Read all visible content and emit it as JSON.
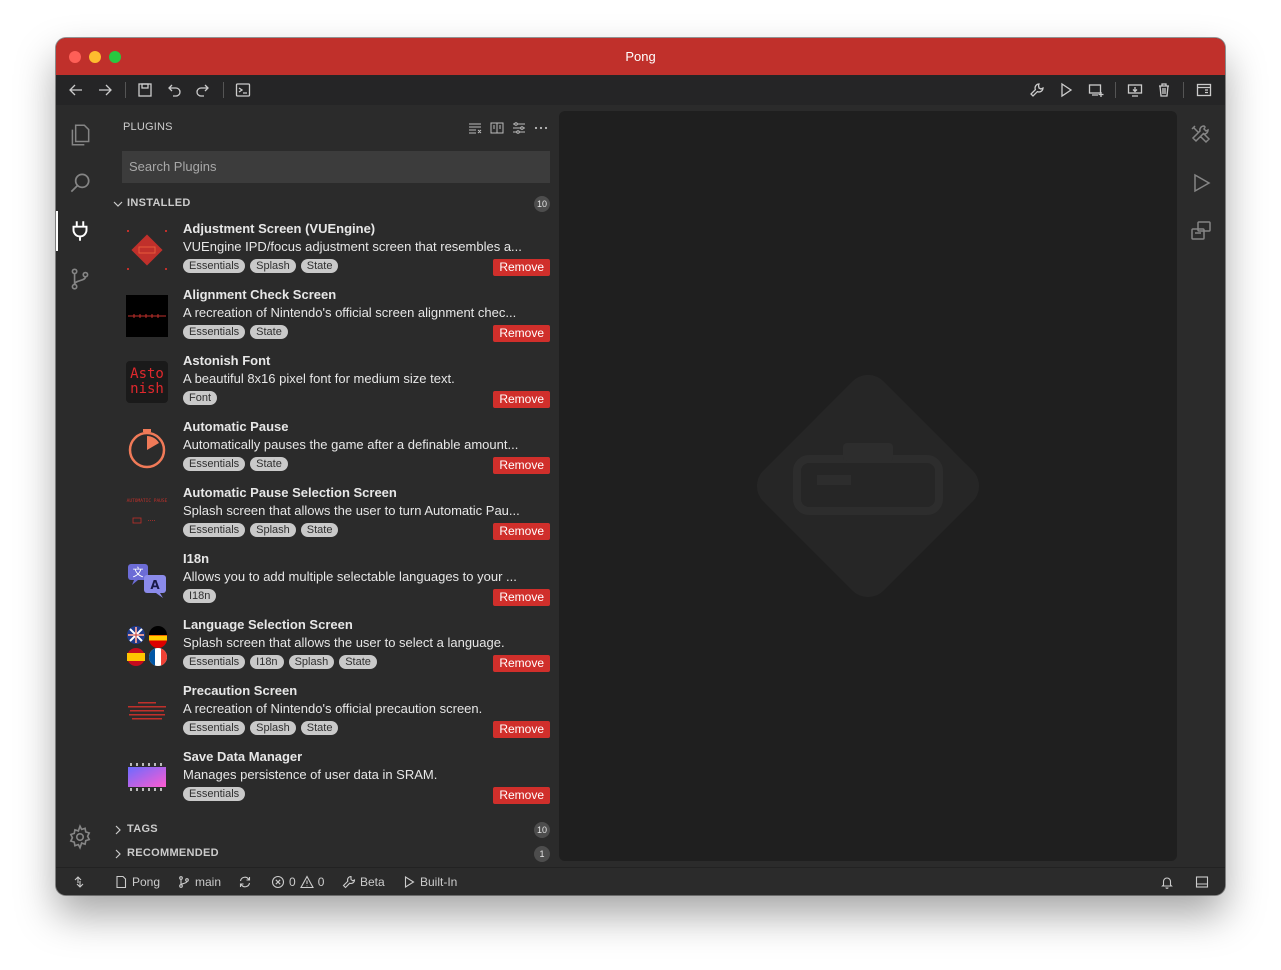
{
  "window": {
    "title": "Pong",
    "accent": "#c0302b"
  },
  "toolbar": {
    "left_icons": [
      "arrow-left-icon",
      "arrow-right-icon",
      "save-icon",
      "undo-icon",
      "redo-icon",
      "terminal-icon"
    ],
    "right_icons": [
      "wrench-icon",
      "run-icon",
      "add-emulator-icon",
      "flash-device-icon",
      "trash-icon",
      "layout-icon"
    ]
  },
  "activity_bar": [
    "explorer-icon",
    "search-icon",
    "plugins-icon",
    "source-control-icon"
  ],
  "sidebar": {
    "title": "PLUGINS",
    "search_placeholder": "Search Plugins",
    "installed": {
      "label": "INSTALLED",
      "count": "10"
    },
    "tags": {
      "label": "TAGS",
      "count": "10"
    },
    "recommended": {
      "label": "RECOMMENDED",
      "count": "1"
    },
    "remove_label": "Remove",
    "plugins": [
      {
        "name": "Adjustment Screen (VUEngine)",
        "description": "VUEngine IPD/focus adjustment screen that resembles a...",
        "tags": [
          "Essentials",
          "Splash",
          "State"
        ],
        "icon": "adjustment-screen-icon"
      },
      {
        "name": "Alignment Check Screen",
        "description": "A recreation of Nintendo's official screen alignment chec...",
        "tags": [
          "Essentials",
          "State"
        ],
        "icon": "alignment-check-icon"
      },
      {
        "name": "Astonish Font",
        "description": "A beautiful 8x16 pixel font for medium size text.",
        "tags": [
          "Font"
        ],
        "icon": "astonish-font-icon",
        "icon_text": [
          "Asto",
          "nish"
        ]
      },
      {
        "name": "Automatic Pause",
        "description": "Automatically pauses the game after a definable amount...",
        "tags": [
          "Essentials",
          "State"
        ],
        "icon": "timer-icon"
      },
      {
        "name": "Automatic Pause Selection Screen",
        "description": "Splash screen that allows the user to turn Automatic Pau...",
        "tags": [
          "Essentials",
          "Splash",
          "State"
        ],
        "icon": "automatic-pause-screen-icon",
        "icon_text": [
          "AUTOMATIC PAUSE"
        ]
      },
      {
        "name": "I18n",
        "description": "Allows you to add multiple selectable languages to your ...",
        "tags": [
          "I18n"
        ],
        "icon": "translate-icon"
      },
      {
        "name": "Language Selection Screen",
        "description": "Splash screen that allows the user to select a language.",
        "tags": [
          "Essentials",
          "I18n",
          "Splash",
          "State"
        ],
        "icon": "flags-icon"
      },
      {
        "name": "Precaution Screen",
        "description": "A recreation of Nintendo's official precaution screen.",
        "tags": [
          "Essentials",
          "Splash",
          "State"
        ],
        "icon": "precaution-screen-icon"
      },
      {
        "name": "Save Data Manager",
        "description": "Manages persistence of user data in SRAM.",
        "tags": [
          "Essentials"
        ],
        "icon": "memory-chip-icon"
      }
    ]
  },
  "right_bar": [
    "tools-icon",
    "run-icon",
    "emulator-icon"
  ],
  "statusbar": {
    "project": "Pong",
    "branch": "main",
    "errors": "0",
    "warnings": "0",
    "channel": "Beta",
    "emulator": "Built-In"
  }
}
